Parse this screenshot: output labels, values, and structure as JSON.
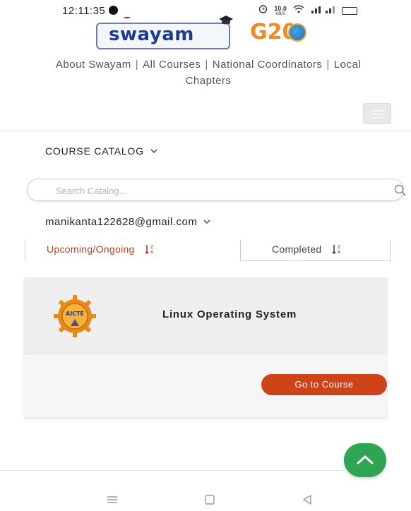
{
  "status_bar": {
    "time": "12:11:35",
    "net_speed_value": "10.0",
    "net_speed_unit": "KB/S"
  },
  "header": {
    "swayam_logo_text": "swayam",
    "g20_logo_text": "G20",
    "nav_links": [
      "About Swayam",
      "All Courses",
      "National Coordinators",
      "Local Chapters"
    ]
  },
  "catalog": {
    "toggle_label": "COURSE CATALOG",
    "search_placeholder": "Search Catalog..."
  },
  "user": {
    "email": "manikanta122628@gmail.com"
  },
  "tabs": [
    {
      "label": "Upcoming/Ongoing",
      "active": true
    },
    {
      "label": "Completed",
      "active": false
    }
  ],
  "course": {
    "logo_text": "AICTE",
    "title": "Linux Operating System",
    "button_label": "Go to Course"
  },
  "colors": {
    "accent": "#cf4318",
    "scroll_top": "#2ea553",
    "brand_blue": "#1c3d8f"
  },
  "icons": [
    "alarm-icon",
    "wifi-icon",
    "signal-icon",
    "battery-icon",
    "search-icon",
    "sort-icon",
    "chevron-down-icon",
    "chevron-up-icon",
    "menu-icon",
    "home-icon",
    "back-icon"
  ]
}
